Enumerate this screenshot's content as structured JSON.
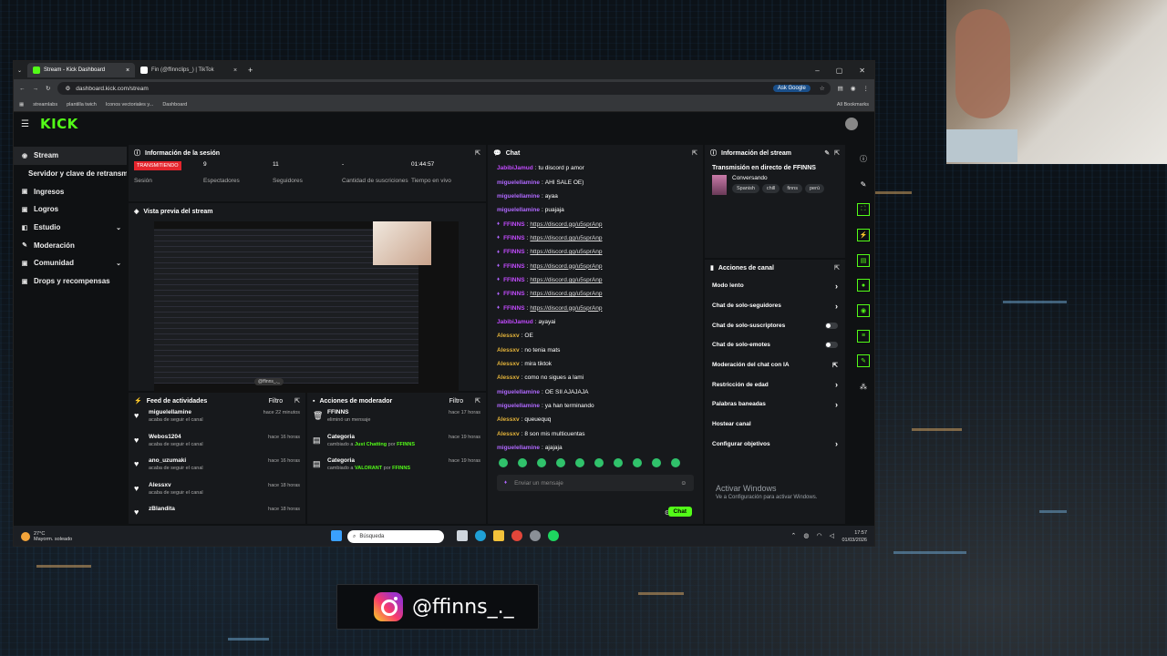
{
  "browser": {
    "tabs": [
      {
        "title": "Stream - Kick Dashboard",
        "active": true,
        "fav_color": "#53fc18"
      },
      {
        "title": "Fin (@ffinnclips_) | TikTok",
        "active": false,
        "fav_color": "#ffffff"
      }
    ],
    "url": "dashboard.kick.com/stream",
    "ask_google": "Ask Google",
    "bookmarks": [
      "streamlabs",
      "plantilla twich",
      "Iconos vectoriales y...",
      "Dashboard"
    ],
    "all_bookmarks": "All Bookmarks"
  },
  "kick": {
    "logo": "KICK",
    "sidebar": [
      {
        "label": "Stream",
        "icon": "broadcast-icon"
      },
      {
        "label": "Servidor y clave de retransmisión",
        "icon": ""
      },
      {
        "label": "Ingresos",
        "icon": "money-icon"
      },
      {
        "label": "Logros",
        "icon": "trophy-icon"
      },
      {
        "label": "Estudio",
        "icon": "studio-icon"
      },
      {
        "label": "Moderación",
        "icon": "wrench-icon"
      },
      {
        "label": "Comunidad",
        "icon": "community-icon"
      },
      {
        "label": "Drops y recompensas",
        "icon": "gift-icon"
      }
    ],
    "session": {
      "title": "Información de la sesión",
      "badge": "TRANSMITIENDO",
      "badge_label": "Sesión",
      "viewers": "9",
      "viewers_label": "Espectadores",
      "followers": "11",
      "followers_label": "Seguidores",
      "subs": "-",
      "subs_label": "Cantidad de suscriciones",
      "uptime": "01:44:57",
      "uptime_label": "Tiempo en vivo"
    },
    "preview": {
      "title": "Vista previa del stream",
      "tag": "@ffinns_._"
    },
    "feed": {
      "title": "Feed de actividades",
      "filter": "Filtro",
      "items": [
        {
          "name": "miguelellamine",
          "desc": "acaba de seguir el canal",
          "time": "hace 22 minutos"
        },
        {
          "name": "Webos1204",
          "desc": "acaba de seguir el canal",
          "time": "hace 16 horas"
        },
        {
          "name": "ano_uzumaki",
          "desc": "acaba de seguir el canal",
          "time": "hace 16 horas"
        },
        {
          "name": "Alessxv",
          "desc": "acaba de seguir el canal",
          "time": "hace 18 horas"
        },
        {
          "name": "zBlandita",
          "desc": "",
          "time": "hace 18 horas"
        }
      ]
    },
    "mod": {
      "title": "Acciones de moderador",
      "filter": "Filtro",
      "items": [
        {
          "name": "FFINNS",
          "desc_a": "eliminó un mensaje",
          "cat": "",
          "by_pre": "",
          "by": "",
          "time": "hace 17 horas"
        },
        {
          "name": "Categoria",
          "desc_a": "cambiado a",
          "cat": "Just Chatting",
          "by_pre": "por",
          "by": "FFINNS",
          "time": "hace 19 horas"
        },
        {
          "name": "Categoria",
          "desc_a": "cambiado a",
          "cat": "VALORANT",
          "by_pre": "por",
          "by": "FFINNS",
          "time": "hace 19 horas"
        }
      ]
    },
    "chat": {
      "title": "Chat",
      "messages": [
        {
          "user": "JabibiJamud",
          "color": "#c34bff",
          "badge": false,
          "text": "tu discord p amor",
          "link": false
        },
        {
          "user": "miguelellamine",
          "color": "#b068ff",
          "badge": false,
          "text": "AHI SALE OE)",
          "link": false
        },
        {
          "user": "miguelellamine",
          "color": "#b068ff",
          "badge": false,
          "text": "ayaa",
          "link": false
        },
        {
          "user": "miguelellamine",
          "color": "#b068ff",
          "badge": false,
          "text": "puajaja",
          "link": false
        },
        {
          "user": "FFINNS",
          "color": "#c34bff",
          "badge": true,
          "text": "https://discord.gg/u5sprAnp",
          "link": true
        },
        {
          "user": "FFINNS",
          "color": "#c34bff",
          "badge": true,
          "text": "https://discord.gg/u5sprAnp",
          "link": true
        },
        {
          "user": "FFINNS",
          "color": "#c34bff",
          "badge": true,
          "text": "https://discord.gg/u5sprAnp",
          "link": true
        },
        {
          "user": "FFINNS",
          "color": "#c34bff",
          "badge": true,
          "text": "https://discord.gg/u5sprAnp",
          "link": true
        },
        {
          "user": "FFINNS",
          "color": "#c34bff",
          "badge": true,
          "text": "https://discord.gg/u5sprAnp",
          "link": true
        },
        {
          "user": "FFINNS",
          "color": "#c34bff",
          "badge": true,
          "text": "https://discord.gg/u5sprAnp",
          "link": true
        },
        {
          "user": "FFINNS",
          "color": "#c34bff",
          "badge": true,
          "text": "https://discord.gg/u5sprAnp",
          "link": true
        },
        {
          "user": "JabibiJamud",
          "color": "#c34bff",
          "badge": false,
          "text": "ayayai",
          "link": false
        },
        {
          "user": "Alessxv",
          "color": "#e3b33a",
          "badge": false,
          "text": "OE",
          "link": false
        },
        {
          "user": "Alessxv",
          "color": "#e3b33a",
          "badge": false,
          "text": "no tenia mats",
          "link": false
        },
        {
          "user": "Alessxv",
          "color": "#e3b33a",
          "badge": false,
          "text": "mira tiktok",
          "link": false
        },
        {
          "user": "Alessxv",
          "color": "#e3b33a",
          "badge": false,
          "text": "como no sigues a lami",
          "link": false
        },
        {
          "user": "miguelellamine",
          "color": "#b068ff",
          "badge": false,
          "text": "OE SII AJAJAJA",
          "link": false
        },
        {
          "user": "miguelellamine",
          "color": "#b068ff",
          "badge": false,
          "text": "ya han terminando",
          "link": false
        },
        {
          "user": "Alessxv",
          "color": "#e3b33a",
          "badge": false,
          "text": "queuequq",
          "link": false
        },
        {
          "user": "Alessxv",
          "color": "#e3b33a",
          "badge": false,
          "text": "8 son mis multicuentas",
          "link": false
        },
        {
          "user": "miguelellamine",
          "color": "#b068ff",
          "badge": false,
          "text": "ajajaja",
          "link": false
        }
      ],
      "input_placeholder": "Enviar un mensaje",
      "send": "Chat"
    },
    "stream_info": {
      "title": "Información del stream",
      "stream_title": "Transmisión en directo de FFINNS",
      "category": "Conversando",
      "tags": [
        "Spanish",
        "chill",
        "finns",
        "perú"
      ]
    },
    "channel_actions": {
      "title": "Acciones de canal",
      "items": [
        {
          "label": "Modo lento",
          "ctrl": "arrow"
        },
        {
          "label": "Chat de solo-seguidores",
          "ctrl": "arrow"
        },
        {
          "label": "Chat de solo-suscriptores",
          "ctrl": "toggle"
        },
        {
          "label": "Chat de solo-emotes",
          "ctrl": "toggle"
        },
        {
          "label": "Moderación del chat con IA",
          "ctrl": "ext"
        },
        {
          "label": "Restricción de edad",
          "ctrl": "arrow"
        },
        {
          "label": "Palabras baneadas",
          "ctrl": "arrow"
        },
        {
          "label": "Hostear canal",
          "ctrl": "none"
        },
        {
          "label": "Configurar objetivos",
          "ctrl": "arrow"
        }
      ]
    },
    "activate": {
      "line1": "Activar Windows",
      "line2": "Ve a Configuración para activar Windows."
    }
  },
  "taskbar": {
    "temp": "27°C",
    "weather": "Mayorm. soleado",
    "search": "Búsqueda",
    "time": "17:57",
    "date": "01/03/2026"
  },
  "overlay": {
    "instagram_handle": "@ffinns_._"
  },
  "colors": {
    "accent": "#53fc18",
    "live": "#e5252d"
  }
}
